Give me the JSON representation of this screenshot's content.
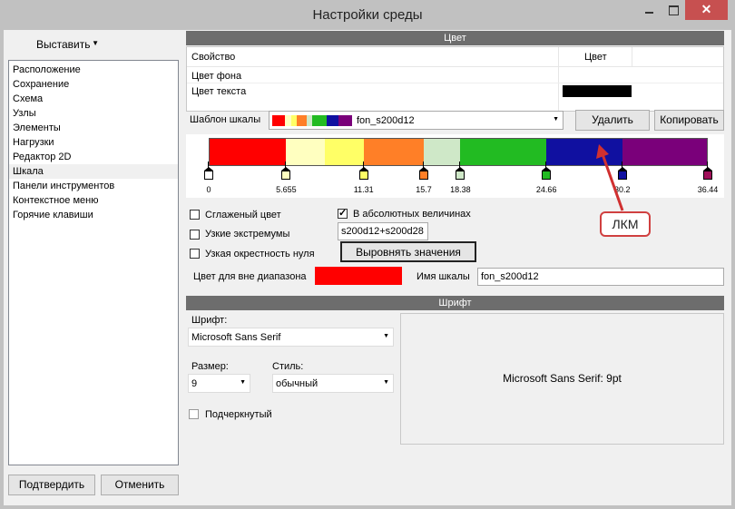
{
  "window": {
    "title": "Настройки среды",
    "close_glyph": "✕"
  },
  "sidebar": {
    "dropdown_label": "Выставить",
    "items": [
      "Расположение",
      "Сохранение",
      "Схема",
      "Узлы",
      "Элементы",
      "Нагрузки",
      "Редактор 2D",
      "Шкала",
      "Панели инструментов",
      "Контекстное меню",
      "Горячие клавиши"
    ],
    "selected": "Шкала",
    "confirm_label": "Подтвердить",
    "cancel_label": "Отменить"
  },
  "color_section": {
    "header": "Цвет",
    "col_property": "Свойство",
    "col_color": "Цвет",
    "rows": [
      {
        "name": "Цвет фона",
        "swatch": "#ffffff"
      },
      {
        "name": "Цвет текста",
        "swatch": "#000000"
      }
    ],
    "template_label": "Шаблон шкалы",
    "template_value": "fon_s200d12",
    "delete_label": "Удалить",
    "copy_label": "Копировать",
    "scale_bands": [
      {
        "color": "#ff0000",
        "from": 0,
        "to": 5.655
      },
      {
        "color": "#ffffc0",
        "from": 5.655,
        "to": 8.5
      },
      {
        "color": "#ffff66",
        "from": 8.5,
        "to": 11.31
      },
      {
        "color": "#ff7f27",
        "from": 11.31,
        "to": 15.7
      },
      {
        "color": "#cfe8c8",
        "from": 15.7,
        "to": 18.38
      },
      {
        "color": "#22bb22",
        "from": 18.38,
        "to": 24.66
      },
      {
        "color": "#1010a0",
        "from": 24.66,
        "to": 30.2
      },
      {
        "color": "#7a007a",
        "from": 30.2,
        "to": 36.44
      }
    ],
    "ticks": [
      "0",
      "5.655",
      "11.31",
      "15.7",
      "18.38",
      "24.66",
      "30.2",
      "36.44"
    ],
    "marker_colors": [
      "#ffffff",
      "#ffffc0",
      "#ffff66",
      "#ff7f27",
      "#cfe8c8",
      "#22bb22",
      "#1010a0",
      "#a0105a"
    ],
    "smooth_label": "Сглаженый цвет",
    "narrow_extremes_label": "Узкие экстремумы",
    "narrow_zero_label": "Узкая окрестность нуля",
    "absolute_label": "В абсолютных величинах",
    "absolute_checked": true,
    "formula_value": "s200d12+s200d28",
    "align_label": "Выровнять значения",
    "out_of_range_label": "Цвет для вне диапазона",
    "out_of_range_color": "#ff0000",
    "scale_name_label": "Имя шкалы",
    "scale_name_value": "fon_s200d12"
  },
  "font_section": {
    "header": "Шрифт",
    "font_label": "Шрифт:",
    "font_value": "Microsoft Sans Serif",
    "size_label": "Размер:",
    "size_value": "9",
    "style_label": "Стиль:",
    "style_value": "обычный",
    "underline_label": "Подчеркнутый",
    "preview_text": "Microsoft Sans Serif: 9pt"
  },
  "annotation": {
    "text": "ЛКМ",
    "color": "#d03030"
  }
}
